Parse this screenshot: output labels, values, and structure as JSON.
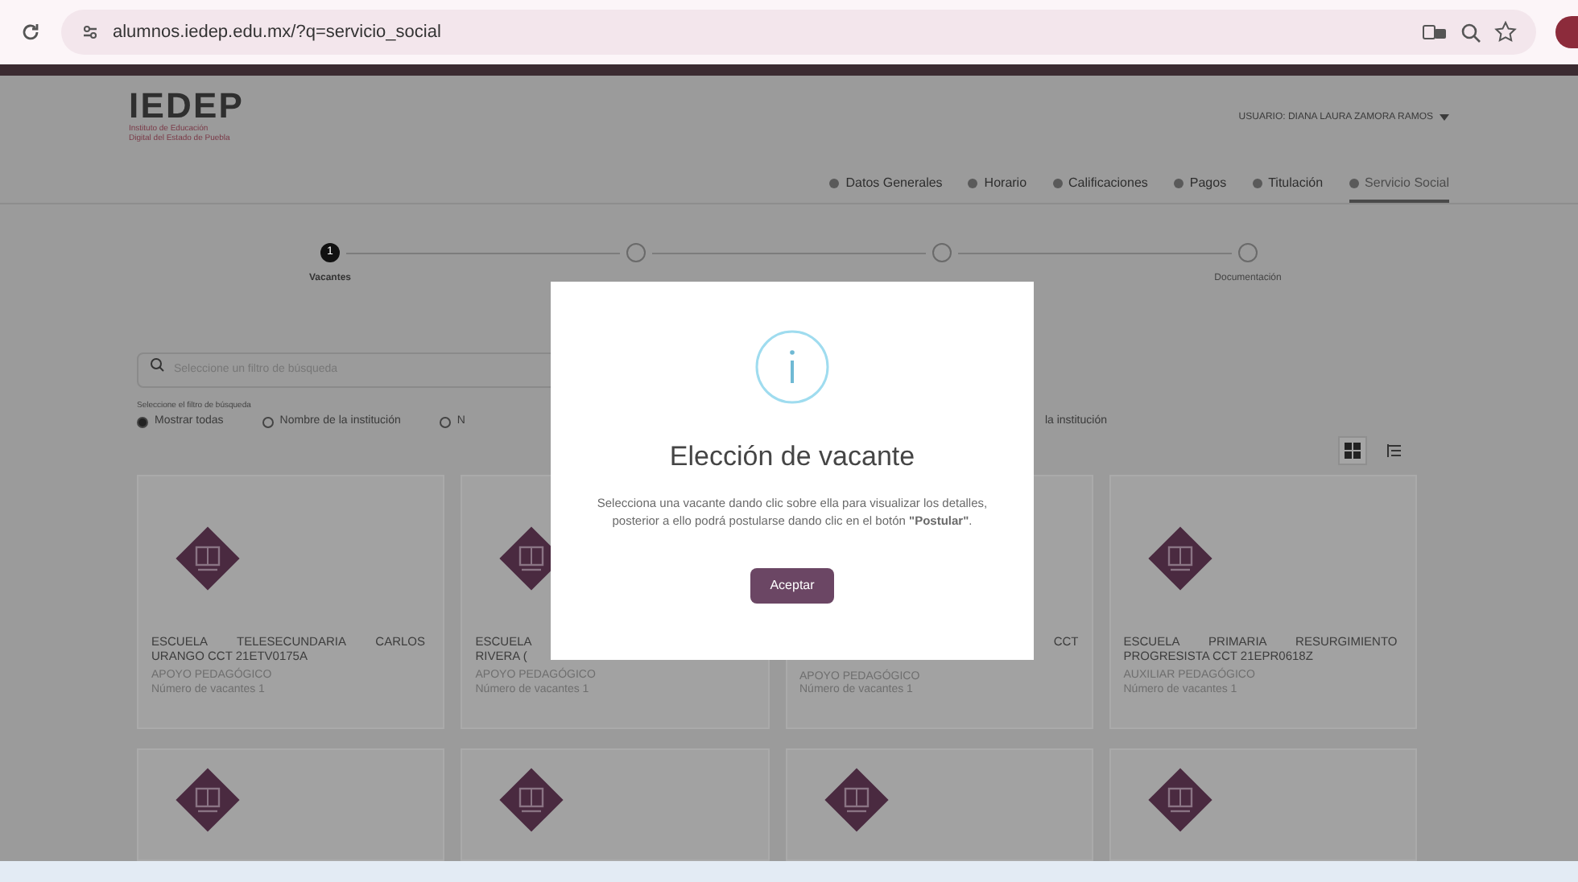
{
  "browser": {
    "url": "alumnos.iedep.edu.mx/?q=servicio_social"
  },
  "header": {
    "logo": "IEDEP",
    "logo_subtitle": [
      "Instituto de Educación",
      "Digital del Estado de Puebla"
    ],
    "user": "USUARIO: DIANA LAURA ZAMORA RAMOS"
  },
  "nav": [
    {
      "label": "Datos Generales",
      "selected": false
    },
    {
      "label": "Horario",
      "selected": false
    },
    {
      "label": "Calificaciones",
      "selected": false
    },
    {
      "label": "Pagos",
      "selected": false
    },
    {
      "label": "Titulación",
      "selected": false
    },
    {
      "label": "Servicio Social",
      "selected": true
    }
  ],
  "stepper": [
    {
      "number": "1",
      "label": "Vacantes",
      "selected": true
    },
    {
      "selected": false
    },
    {
      "selected": false
    },
    {
      "label": "Documentación",
      "selected": false
    }
  ],
  "search": {
    "placeholder": "Seleccione un filtro de búsqueda"
  },
  "filter_label": "Seleccione el filtro de búsqueda",
  "filters": [
    {
      "label": "Mostrar todas",
      "selected": true
    },
    {
      "label": "Nombre de la institución",
      "selected": false
    },
    {
      "label": "N",
      "selected": false
    }
  ],
  "filter_fragment": "la institución",
  "view_toggle": [
    {
      "kind": "grid",
      "selected": true
    },
    {
      "kind": "list",
      "selected": false
    }
  ],
  "cards": [
    {
      "kind": "full",
      "title": "ESCUELA TELESECUNDARIA CARLOS URANGO CCT 21ETV0175A",
      "area": "APOYO PEDAGÓGICO",
      "vacancies": "Número de vacantes 1"
    },
    {
      "kind": "covered_right",
      "title_lines": [
        "ESCUELA",
        "RIVERA ("
      ],
      "area": "APOYO PEDAGÓGICO",
      "vacancies": "Número de vacantes 1"
    },
    {
      "kind": "covered_left",
      "title_lines": [
        "CCT"
      ],
      "area": "APOYO PEDAGÓGICO",
      "vacancies": "Número de vacantes 1"
    },
    {
      "kind": "full",
      "title": "ESCUELA PRIMARIA RESURGIMIENTO PROGRESISTA CCT 21EPR0618Z",
      "area": "AUXILIAR PEDAGÓGICO",
      "vacancies": "Número de vacantes 1"
    },
    {
      "kind": "cut"
    },
    {
      "kind": "cut"
    },
    {
      "kind": "cut"
    },
    {
      "kind": "cut"
    }
  ],
  "modal": {
    "title": "Elección de vacante",
    "message": "Selecciona una vacante dando clic sobre ella para visualizar los detalles, posterior a ello podrá postularse dando clic en el botón **\"Postular\"**.",
    "button": "Aceptar"
  }
}
